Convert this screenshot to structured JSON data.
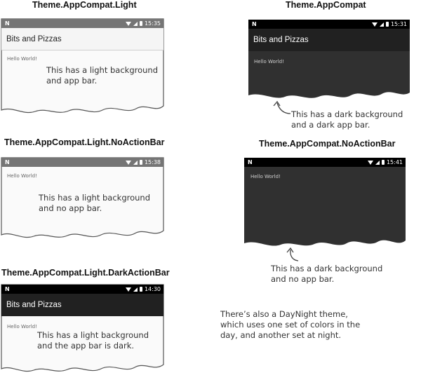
{
  "app_title": "Bits and Pizzas",
  "hello_text": "Hello World!",
  "themes": [
    {
      "title": "Theme.AppCompat.Light",
      "time": "15:35",
      "note": "This has a light background\nand app bar."
    },
    {
      "title": "Theme.AppCompat",
      "time": "15:31",
      "note": "This has a dark background\nand a dark app bar."
    },
    {
      "title": "Theme.AppCompat.Light.NoActionBar",
      "time": "15:38",
      "note": "This has a light background\nand no app bar."
    },
    {
      "title": "Theme.AppCompat.NoActionBar",
      "time": "15:41",
      "note": "This has a dark background\nand no app bar."
    },
    {
      "title": "Theme.AppCompat.Light.DarkActionBar",
      "time": "14:30",
      "note": "This has a light background\nand the app bar is dark."
    }
  ],
  "daynight_note": "There’s also a DayNight theme,\nwhich uses one set of colors in the\nday, and another set at night.",
  "status_icon": "n-logo-icon",
  "colors": {
    "status_light": "#757575",
    "status_dark": "#000000",
    "appbar_light": "#f5f5f5",
    "appbar_dark": "#212121",
    "body_light": "#fafafa",
    "body_dark": "#303030"
  }
}
